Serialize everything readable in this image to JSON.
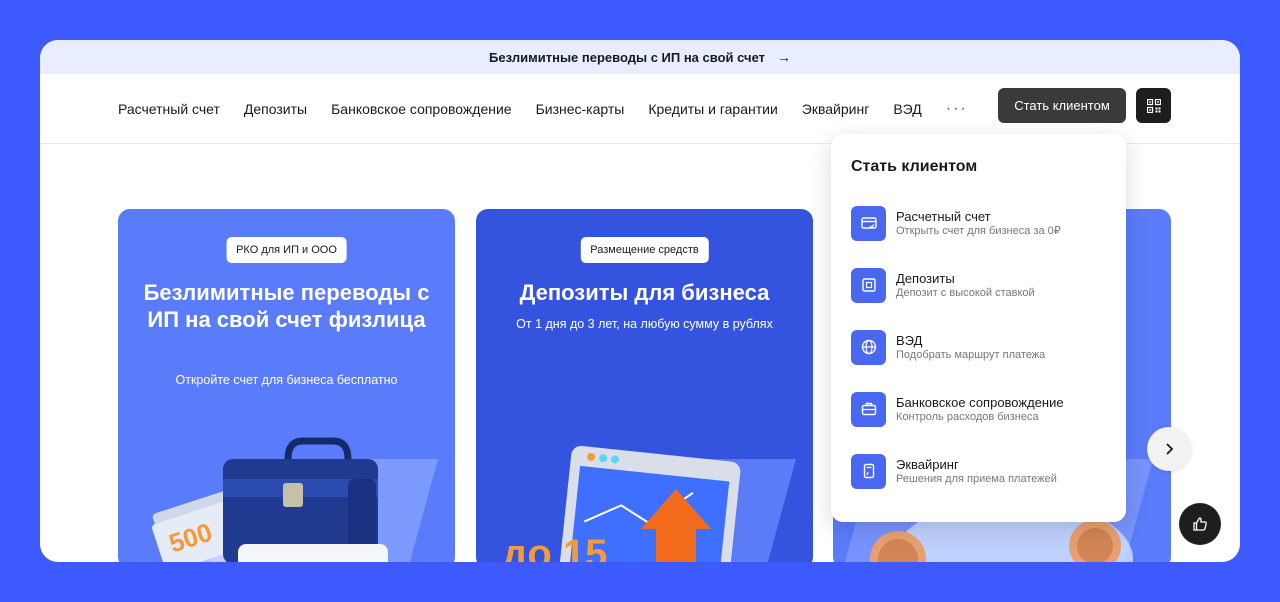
{
  "promo": {
    "text": "Безлимитные переводы с ИП на свой счет",
    "arrow": "→"
  },
  "nav": {
    "items": [
      "Расчетный счет",
      "Депозиты",
      "Банковское сопровождение",
      "Бизнес-карты",
      "Кредиты и гарантии",
      "Эквайринг",
      "ВЭД"
    ],
    "more": "···",
    "cta": "Стать клиентом"
  },
  "cards": [
    {
      "tag": "РКО для ИП и ООО",
      "title": "Безлимитные переводы с ИП на свой счет физлица",
      "subtitle": "Откройте счет для бизнеса бесплатно",
      "illustration_text": "500"
    },
    {
      "tag": "Размещение средств",
      "title": "Депозиты для бизнеса",
      "subtitle": "От 1 дня до 3 лет, на любую сумму в рублях",
      "illustration_text": "до 15"
    }
  ],
  "dropdown": {
    "title": "Стать клиентом",
    "items": [
      {
        "label": "Расчетный счет",
        "desc": "Открыть счет для бизнеса за 0₽",
        "icon": "card-icon"
      },
      {
        "label": "Депозиты",
        "desc": "Депозит с высокой ставкой",
        "icon": "safe-icon"
      },
      {
        "label": "ВЭД",
        "desc": "Подобрать маршрут платежа",
        "icon": "globe-icon"
      },
      {
        "label": "Банковское сопровождение",
        "desc": "Контроль расходов бизнеса",
        "icon": "briefcase-icon"
      },
      {
        "label": "Эквайринг",
        "desc": "Решения для приема платежей",
        "icon": "terminal-icon"
      }
    ]
  },
  "colors": {
    "accent": "#3d5afe",
    "card_blue": "#5b7cfa",
    "card_dark_blue": "#3454e0",
    "icon_blue": "#4a67f0",
    "dark_button": "#3a3a3a"
  }
}
